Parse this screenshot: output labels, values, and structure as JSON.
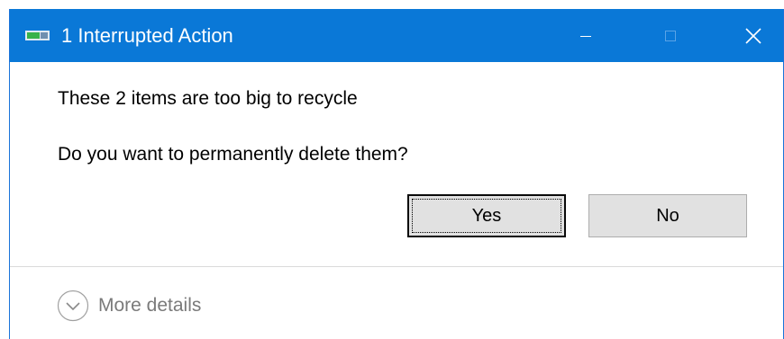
{
  "window": {
    "title": "1 Interrupted Action",
    "accent_color": "#0a78d7",
    "controls": {
      "minimize": "minimize-icon",
      "maximize": "maximize-icon",
      "close": "close-icon"
    }
  },
  "message": {
    "line1": "These 2 items are too big to recycle",
    "line2": "Do you want to permanently delete them?"
  },
  "buttons": {
    "yes_label": "Yes",
    "no_label": "No"
  },
  "footer": {
    "details_label": "More details",
    "details_icon": "chevron-down-circle-icon"
  }
}
